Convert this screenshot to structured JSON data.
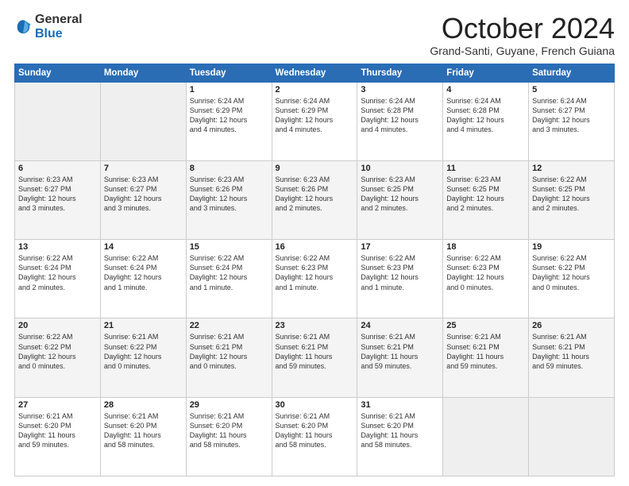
{
  "logo": {
    "general": "General",
    "blue": "Blue"
  },
  "header": {
    "month": "October 2024",
    "location": "Grand-Santi, Guyane, French Guiana"
  },
  "weekdays": [
    "Sunday",
    "Monday",
    "Tuesday",
    "Wednesday",
    "Thursday",
    "Friday",
    "Saturday"
  ],
  "weeks": [
    [
      {
        "day": "",
        "info": ""
      },
      {
        "day": "",
        "info": ""
      },
      {
        "day": "1",
        "info": "Sunrise: 6:24 AM\nSunset: 6:29 PM\nDaylight: 12 hours\nand 4 minutes."
      },
      {
        "day": "2",
        "info": "Sunrise: 6:24 AM\nSunset: 6:29 PM\nDaylight: 12 hours\nand 4 minutes."
      },
      {
        "day": "3",
        "info": "Sunrise: 6:24 AM\nSunset: 6:28 PM\nDaylight: 12 hours\nand 4 minutes."
      },
      {
        "day": "4",
        "info": "Sunrise: 6:24 AM\nSunset: 6:28 PM\nDaylight: 12 hours\nand 4 minutes."
      },
      {
        "day": "5",
        "info": "Sunrise: 6:24 AM\nSunset: 6:27 PM\nDaylight: 12 hours\nand 3 minutes."
      }
    ],
    [
      {
        "day": "6",
        "info": "Sunrise: 6:23 AM\nSunset: 6:27 PM\nDaylight: 12 hours\nand 3 minutes."
      },
      {
        "day": "7",
        "info": "Sunrise: 6:23 AM\nSunset: 6:27 PM\nDaylight: 12 hours\nand 3 minutes."
      },
      {
        "day": "8",
        "info": "Sunrise: 6:23 AM\nSunset: 6:26 PM\nDaylight: 12 hours\nand 3 minutes."
      },
      {
        "day": "9",
        "info": "Sunrise: 6:23 AM\nSunset: 6:26 PM\nDaylight: 12 hours\nand 2 minutes."
      },
      {
        "day": "10",
        "info": "Sunrise: 6:23 AM\nSunset: 6:25 PM\nDaylight: 12 hours\nand 2 minutes."
      },
      {
        "day": "11",
        "info": "Sunrise: 6:23 AM\nSunset: 6:25 PM\nDaylight: 12 hours\nand 2 minutes."
      },
      {
        "day": "12",
        "info": "Sunrise: 6:22 AM\nSunset: 6:25 PM\nDaylight: 12 hours\nand 2 minutes."
      }
    ],
    [
      {
        "day": "13",
        "info": "Sunrise: 6:22 AM\nSunset: 6:24 PM\nDaylight: 12 hours\nand 2 minutes."
      },
      {
        "day": "14",
        "info": "Sunrise: 6:22 AM\nSunset: 6:24 PM\nDaylight: 12 hours\nand 1 minute."
      },
      {
        "day": "15",
        "info": "Sunrise: 6:22 AM\nSunset: 6:24 PM\nDaylight: 12 hours\nand 1 minute."
      },
      {
        "day": "16",
        "info": "Sunrise: 6:22 AM\nSunset: 6:23 PM\nDaylight: 12 hours\nand 1 minute."
      },
      {
        "day": "17",
        "info": "Sunrise: 6:22 AM\nSunset: 6:23 PM\nDaylight: 12 hours\nand 1 minute."
      },
      {
        "day": "18",
        "info": "Sunrise: 6:22 AM\nSunset: 6:23 PM\nDaylight: 12 hours\nand 0 minutes."
      },
      {
        "day": "19",
        "info": "Sunrise: 6:22 AM\nSunset: 6:22 PM\nDaylight: 12 hours\nand 0 minutes."
      }
    ],
    [
      {
        "day": "20",
        "info": "Sunrise: 6:22 AM\nSunset: 6:22 PM\nDaylight: 12 hours\nand 0 minutes."
      },
      {
        "day": "21",
        "info": "Sunrise: 6:21 AM\nSunset: 6:22 PM\nDaylight: 12 hours\nand 0 minutes."
      },
      {
        "day": "22",
        "info": "Sunrise: 6:21 AM\nSunset: 6:21 PM\nDaylight: 12 hours\nand 0 minutes."
      },
      {
        "day": "23",
        "info": "Sunrise: 6:21 AM\nSunset: 6:21 PM\nDaylight: 11 hours\nand 59 minutes."
      },
      {
        "day": "24",
        "info": "Sunrise: 6:21 AM\nSunset: 6:21 PM\nDaylight: 11 hours\nand 59 minutes."
      },
      {
        "day": "25",
        "info": "Sunrise: 6:21 AM\nSunset: 6:21 PM\nDaylight: 11 hours\nand 59 minutes."
      },
      {
        "day": "26",
        "info": "Sunrise: 6:21 AM\nSunset: 6:21 PM\nDaylight: 11 hours\nand 59 minutes."
      }
    ],
    [
      {
        "day": "27",
        "info": "Sunrise: 6:21 AM\nSunset: 6:20 PM\nDaylight: 11 hours\nand 59 minutes."
      },
      {
        "day": "28",
        "info": "Sunrise: 6:21 AM\nSunset: 6:20 PM\nDaylight: 11 hours\nand 58 minutes."
      },
      {
        "day": "29",
        "info": "Sunrise: 6:21 AM\nSunset: 6:20 PM\nDaylight: 11 hours\nand 58 minutes."
      },
      {
        "day": "30",
        "info": "Sunrise: 6:21 AM\nSunset: 6:20 PM\nDaylight: 11 hours\nand 58 minutes."
      },
      {
        "day": "31",
        "info": "Sunrise: 6:21 AM\nSunset: 6:20 PM\nDaylight: 11 hours\nand 58 minutes."
      },
      {
        "day": "",
        "info": ""
      },
      {
        "day": "",
        "info": ""
      }
    ]
  ]
}
